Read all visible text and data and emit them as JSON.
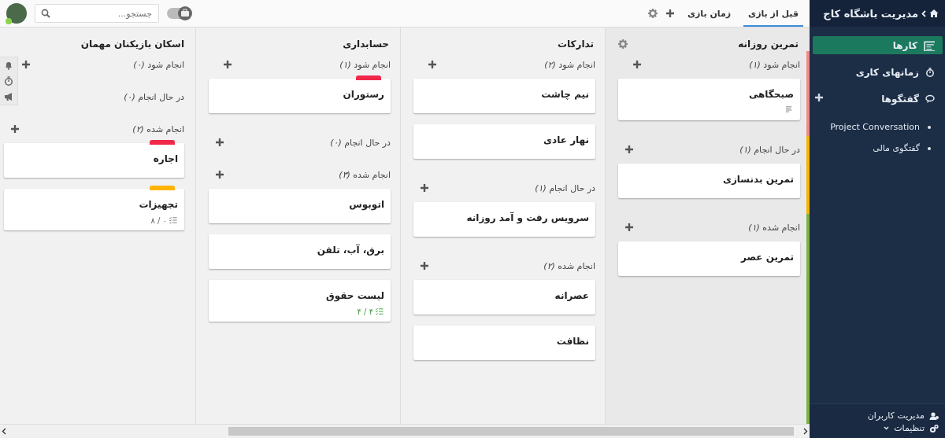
{
  "topbar": {
    "tabs": [
      {
        "label": "قبل از بازی",
        "selected": true
      },
      {
        "label": "زمان بازی",
        "selected": false
      }
    ],
    "search": {
      "placeholder": "جستجو..."
    },
    "toggle": {
      "on": false
    },
    "user": {
      "online": true
    }
  },
  "sidebar": {
    "title": "مدیریت باشگاه کاج",
    "items": [
      {
        "label": "کارها",
        "selected": true,
        "addable": false
      },
      {
        "label": "زمانهای کاری",
        "selected": false,
        "addable": false
      },
      {
        "label": "گفتگوها",
        "selected": false,
        "addable": true,
        "children": [
          {
            "label": "Project Conversation"
          },
          {
            "label": "گفتگوی مالی"
          }
        ]
      }
    ],
    "footer": [
      {
        "label": "مدیریت کاربران",
        "caret": false
      },
      {
        "label": "تنظیمات",
        "caret": true
      }
    ]
  },
  "board": {
    "columns": [
      {
        "title": "تمرین روزانه",
        "settings": true,
        "sections": [
          {
            "title": "انجام شود *(۱)*",
            "color": "#f08a84",
            "cards": [
              {
                "title": "صبحگاهی",
                "description": true
              }
            ]
          },
          {
            "title": "در حال انجام *(۱)*",
            "color": "#f5b400",
            "cards": [
              {
                "title": "تمرین بدنسازی"
              }
            ]
          },
          {
            "title": "انجام شده *(۱)*",
            "color": "#7cb342",
            "cards": [
              {
                "title": "تمرین عصر"
              }
            ]
          }
        ]
      },
      {
        "title": "تدارکات",
        "settings": false,
        "sections": [
          {
            "title": "انجام شود *(۲)*",
            "cards": [
              {
                "title": "نیم چاشت"
              },
              {
                "title": "نهار عادی"
              }
            ]
          },
          {
            "title": "در حال انجام *(۱)*",
            "cards": [
              {
                "title": "سرویس رفت و آمد روزانه"
              }
            ]
          },
          {
            "title": "انجام شده *(۲)*",
            "cards": [
              {
                "title": "عصرانه"
              },
              {
                "title": "نظافت"
              }
            ]
          }
        ]
      },
      {
        "title": "حسابداری",
        "settings": false,
        "sections": [
          {
            "title": "انجام شود *(۱)*",
            "cards": [
              {
                "title": "رستوران",
                "labels": [
                  {
                    "color": "#f0284a"
                  }
                ]
              }
            ]
          },
          {
            "title": "در حال انجام *(۰)*",
            "addable": true
          },
          {
            "title": "انجام شده *(۳)*",
            "cards": [
              {
                "title": "اتوبوس"
              },
              {
                "title": "برق، آب، تلفن"
              },
              {
                "title": "لیست حقوق",
                "checklist": {
                  "text": "۴ / ۴",
                  "complete": true
                }
              }
            ]
          }
        ]
      },
      {
        "title": "اسکان بازیکنان مهمان",
        "settings": false,
        "sections": [
          {
            "title": "انجام شود *(۰)*",
            "addable": true
          },
          {
            "title": "در حال انجام *(۰)*",
            "addable": false
          },
          {
            "title": "انجام شده *(۲)*",
            "cards": [
              {
                "title": "اجاره",
                "labels": [
                  {
                    "color": "#f0284a"
                  }
                ]
              },
              {
                "title": "تجهیزات",
                "labels": [
                  {
                    "color": "#ffb300"
                  }
                ],
                "checklist": {
                  "text": "۸ / ۰",
                  "complete": false
                }
              }
            ]
          }
        ]
      }
    ]
  }
}
